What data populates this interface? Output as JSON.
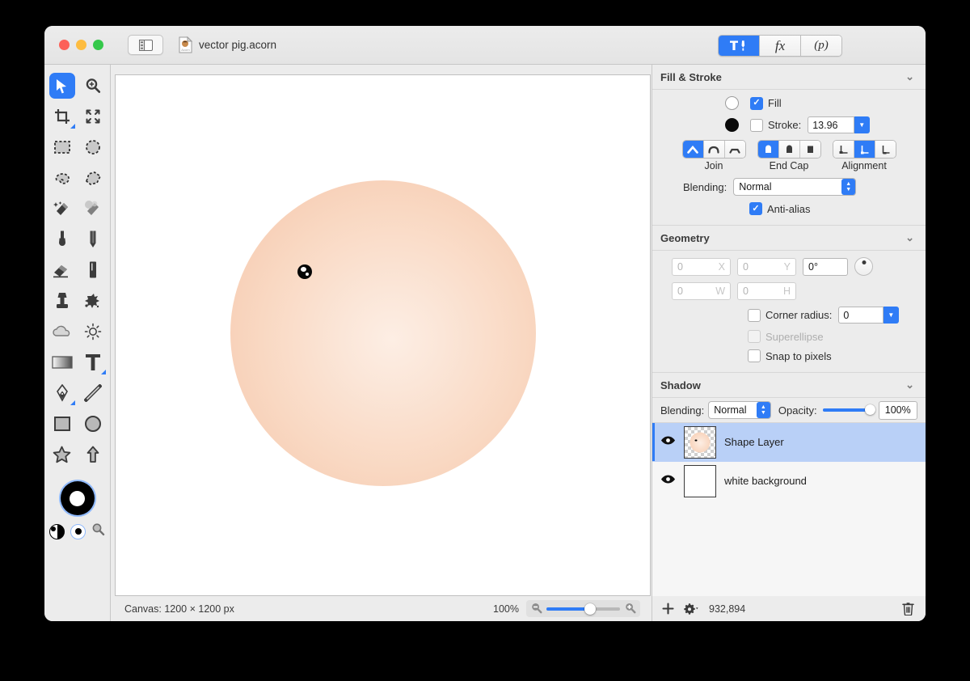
{
  "window": {
    "title": "vector pig.acorn",
    "traffic_lights": [
      "close",
      "minimize",
      "zoom"
    ]
  },
  "toolbar": {
    "sidebar_toggle": "sidebar-toggle",
    "segments": [
      {
        "id": "tools",
        "label": "",
        "icon": "hammer-pen-icon",
        "active": true
      },
      {
        "id": "filters",
        "label": "fx",
        "icon": "fx-icon",
        "active": false
      },
      {
        "id": "presets",
        "label": "(p)",
        "icon": "p-icon",
        "active": false
      }
    ]
  },
  "tools": {
    "items": [
      {
        "name": "move-tool",
        "selected": true
      },
      {
        "name": "zoom-tool",
        "selected": false
      },
      {
        "name": "crop-tool",
        "selected": false
      },
      {
        "name": "transform-tool",
        "selected": false
      },
      {
        "name": "rectangular-select-tool",
        "selected": false
      },
      {
        "name": "elliptical-select-tool",
        "selected": false
      },
      {
        "name": "lasso-tool",
        "selected": false
      },
      {
        "name": "polygon-lasso-tool",
        "selected": false
      },
      {
        "name": "magic-wand-tool",
        "selected": false
      },
      {
        "name": "instant-alpha-tool",
        "selected": false
      },
      {
        "name": "brush-tool",
        "selected": false
      },
      {
        "name": "pencil-tool",
        "selected": false
      },
      {
        "name": "eraser-tool",
        "selected": false
      },
      {
        "name": "marker-tool",
        "selected": false
      },
      {
        "name": "clone-stamp-tool",
        "selected": false
      },
      {
        "name": "smudge-tool",
        "selected": false
      },
      {
        "name": "blur-tool",
        "selected": false
      },
      {
        "name": "dodge-tool",
        "selected": false
      },
      {
        "name": "gradient-tool",
        "selected": false
      },
      {
        "name": "text-tool",
        "selected": false
      },
      {
        "name": "pen-tool",
        "selected": false
      },
      {
        "name": "line-tool",
        "selected": false
      },
      {
        "name": "rectangle-tool",
        "selected": false
      },
      {
        "name": "ellipse-tool",
        "selected": false
      },
      {
        "name": "star-tool",
        "selected": false
      },
      {
        "name": "arrow-tool",
        "selected": false
      }
    ],
    "color_well": {
      "stroke": "#000000",
      "fill": "#ffffff"
    },
    "swap_colors": "swap-colors-icon",
    "default_colors": "default-colors-icon",
    "palette_zoom": "palette-magnifier-icon"
  },
  "canvas": {
    "shape": {
      "type": "ellipse",
      "fill_center": "#fdeee4",
      "fill_edge": "#f7cdb4",
      "eye_color": "#060606"
    }
  },
  "status": {
    "canvas_label": "Canvas: 1200 × 1200 px",
    "zoom_percent": "100%",
    "zoom_out_icon": "zoom-out-icon",
    "zoom_in_icon": "zoom-in-icon"
  },
  "inspector": {
    "fill_stroke": {
      "title": "Fill & Stroke",
      "collapse_icon": "chevron-down-icon",
      "fill": {
        "label": "Fill",
        "checked": true,
        "color": "#ffffff"
      },
      "stroke": {
        "label": "Stroke:",
        "checked": false,
        "color": "#000000",
        "width": "13.96"
      },
      "join": {
        "label": "Join",
        "options": [
          "miter-join",
          "round-join",
          "bevel-join"
        ],
        "selected_index": 0
      },
      "end_cap": {
        "label": "End Cap",
        "options": [
          "butt-cap",
          "round-cap",
          "square-cap"
        ],
        "selected_index": 0
      },
      "alignment": {
        "label": "Alignment",
        "options": [
          "align-inside",
          "align-center",
          "align-outside"
        ],
        "selected_index": 1
      },
      "blending": {
        "label": "Blending:",
        "value": "Normal"
      },
      "anti_alias": {
        "label": "Anti-alias",
        "checked": true
      }
    },
    "geometry": {
      "title": "Geometry",
      "collapse_icon": "chevron-down-icon",
      "x": {
        "value": "0",
        "unit": "X"
      },
      "y": {
        "value": "0",
        "unit": "Y"
      },
      "rotation": {
        "value": "0°"
      },
      "w": {
        "value": "0",
        "unit": "W"
      },
      "h": {
        "value": "0",
        "unit": "H"
      },
      "corner_radius": {
        "label": "Corner radius:",
        "checked": false,
        "value": "0"
      },
      "superellipse": {
        "label": "Superellipse",
        "checked": false,
        "disabled": true
      },
      "snap_to_pixels": {
        "label": "Snap to pixels",
        "checked": false
      }
    },
    "shadow": {
      "title": "Shadow",
      "collapse_icon": "chevron-down-icon"
    },
    "layer_controls": {
      "blending_label": "Blending:",
      "blending_value": "Normal",
      "opacity_label": "Opacity:",
      "opacity_value": "100%"
    },
    "layers": [
      {
        "name": "Shape Layer",
        "visible": true,
        "selected": true,
        "thumb": "shape-thumbnail"
      },
      {
        "name": "white background",
        "visible": true,
        "selected": false,
        "thumb": "white-thumbnail"
      }
    ],
    "layer_toolbar": {
      "add_icon": "add-layer-icon",
      "settings_icon": "gear-icon",
      "count": "932,894",
      "delete_icon": "trash-icon"
    }
  }
}
